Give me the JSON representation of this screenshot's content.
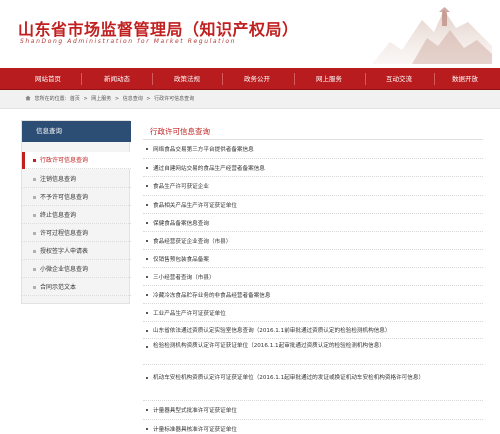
{
  "header": {
    "title": "山东省市场监督管理局（知识产权局）",
    "subtitle": "ShanDong Administration for Market Regulation"
  },
  "nav": {
    "items": [
      "网站首页",
      "新闻动态",
      "政策法规",
      "政务公开",
      "网上服务",
      "互动交流",
      "数据开放"
    ]
  },
  "breadcrumb": {
    "prefix": "您所在的位置:",
    "items": [
      "首页",
      "网上服务",
      "信息查询",
      "行政许可信息查询"
    ]
  },
  "sidebar": {
    "title": "信息查询",
    "items": [
      "行政许可信息查询",
      "注销信息查询",
      "不予许可信息查询",
      "终止信息查询",
      "许可过程信息查询",
      "授权签字人申请表",
      "小微企业信息查询",
      "合同示范文本"
    ],
    "active_index": 0
  },
  "main": {
    "title": "行政许可信息查询",
    "items": [
      "网络食品交易第三方平台提供者备案信息",
      "通过自建网站交易的食品生产经营者备案信息",
      "食品生产许可获证企业",
      "食品相关产品生产许可证获证单位",
      "保健食品备案信息查询",
      "食品经营获证企业查询（市县）",
      "仅销售预包装食品备案",
      "三小经营者查询（市县）",
      "冷藏冷冻食品贮存业务的非食品经营者备案信息",
      "工业产品生产许可证获证单位",
      "山东省依法通过资质认定实验室信息查询（2016.1.1前审批通过资质认定的检验检测机构信息）",
      "检验检测机构资质认定许可证获证单位（2016.1.1起审批通过资质认定的检验检测机构信息）",
      "机动车安检机构资质认定许可证获证单位（2016.1.1起审批通过的发证或换证机动车安检机构资格许可信息）",
      "计量器具型式批准许可证获证单位",
      "计量标准器具核准许可证获证单位"
    ]
  },
  "colors": {
    "brand_red": "#b81c1e",
    "sidebar_header": "#2d4e74",
    "active_text": "#c0201f"
  }
}
